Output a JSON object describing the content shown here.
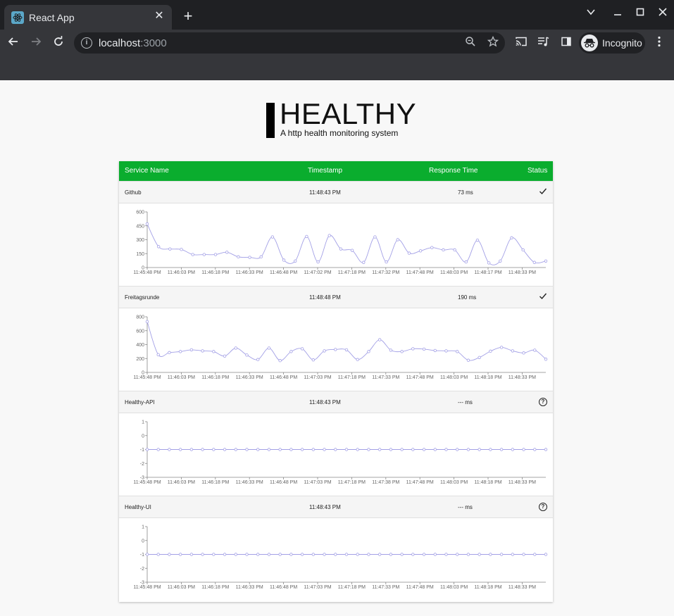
{
  "browser": {
    "tab_title": "React App",
    "url_host": "localhost",
    "url_port": ":3000",
    "profile_label": "Incognito"
  },
  "app": {
    "title": "HEALTHY",
    "subtitle": "A http health monitoring system"
  },
  "table": {
    "headers": [
      "Service Name",
      "Timestamp",
      "Response Time",
      "Status"
    ],
    "header_color": "#0aad2e"
  },
  "services": [
    {
      "name": "Github",
      "timestamp": "11:48:43 PM",
      "response": "73 ms",
      "status": "ok"
    },
    {
      "name": "Freitagsrunde",
      "timestamp": "11:48:48 PM",
      "response": "190 ms",
      "status": "ok"
    },
    {
      "name": "Healthy-API",
      "timestamp": "11:48:43 PM",
      "response": "--- ms",
      "status": "unknown"
    },
    {
      "name": "Healthy-UI",
      "timestamp": "11:48:43 PM",
      "response": "--- ms",
      "status": "unknown"
    }
  ],
  "chart_data": [
    {
      "type": "line",
      "series_color": "#a3a0e6",
      "ylim": [
        0,
        600
      ],
      "yticks": [
        "600",
        "450",
        "300",
        "150",
        "0"
      ],
      "xticks": [
        "11:45:48 PM",
        "11:46:03 PM",
        "11:46:18 PM",
        "11:46:33 PM",
        "11:46:48 PM",
        "11:47:02 PM",
        "11:47:18 PM",
        "11:47:32 PM",
        "11:47:48 PM",
        "11:48:03 PM",
        "11:48:17 PM",
        "11:48:33 PM"
      ],
      "values": [
        470,
        225,
        200,
        195,
        140,
        140,
        140,
        165,
        115,
        110,
        115,
        330,
        80,
        70,
        335,
        60,
        345,
        200,
        185,
        55,
        330,
        60,
        300,
        155,
        180,
        215,
        190,
        190,
        60,
        295,
        50,
        70,
        320,
        190,
        55,
        70
      ]
    },
    {
      "type": "line",
      "series_color": "#a3a0e6",
      "ylim": [
        0,
        800
      ],
      "yticks": [
        "800",
        "600",
        "400",
        "200",
        "0"
      ],
      "xticks": [
        "11:45:48 PM",
        "11:46:03 PM",
        "11:46:18 PM",
        "11:46:33 PM",
        "11:46:48 PM",
        "11:47:03 PM",
        "11:47:18 PM",
        "11:47:33 PM",
        "11:47:48 PM",
        "11:48:03 PM",
        "11:48:18 PM",
        "11:48:33 PM"
      ],
      "values": [
        730,
        255,
        285,
        300,
        325,
        310,
        300,
        235,
        350,
        250,
        185,
        350,
        170,
        300,
        340,
        180,
        310,
        330,
        325,
        185,
        300,
        470,
        320,
        300,
        340,
        335,
        315,
        310,
        300,
        175,
        215,
        305,
        360,
        310,
        280,
        320,
        190
      ]
    },
    {
      "type": "line",
      "series_color": "#a3a0e6",
      "ylim": [
        -3,
        1
      ],
      "yticks": [
        "1",
        "0",
        "-1",
        "-2",
        "-3"
      ],
      "xticks": [
        "11:45:48 PM",
        "11:46:03 PM",
        "11:46:18 PM",
        "11:46:33 PM",
        "11:46:48 PM",
        "11:47:03 PM",
        "11:47:18 PM",
        "11:47:38 PM",
        "11:47:48 PM",
        "11:48:03 PM",
        "11:48:18 PM",
        "11:48:33 PM"
      ],
      "values": [
        -1,
        -1,
        -1,
        -1,
        -1,
        -1,
        -1,
        -1,
        -1,
        -1,
        -1,
        -1,
        -1,
        -1,
        -1,
        -1,
        -1,
        -1,
        -1,
        -1,
        -1,
        -1,
        -1,
        -1,
        -1,
        -1,
        -1,
        -1,
        -1,
        -1,
        -1,
        -1,
        -1,
        -1,
        -1,
        -1,
        -1
      ]
    },
    {
      "type": "line",
      "series_color": "#a3a0e6",
      "ylim": [
        -3,
        1
      ],
      "yticks": [
        "1",
        "0",
        "-1",
        "-2",
        "-3"
      ],
      "xticks": [
        "11:45:48 PM",
        "11:46:03 PM",
        "11:46:18 PM",
        "11:46:33 PM",
        "11:46:48 PM",
        "11:47:03 PM",
        "11:47:18 PM",
        "11:47:33 PM",
        "11:47:48 PM",
        "11:48:03 PM",
        "11:48:18 PM",
        "11:48:33 PM"
      ],
      "values": [
        -1,
        -1,
        -1,
        -1,
        -1,
        -1,
        -1,
        -1,
        -1,
        -1,
        -1,
        -1,
        -1,
        -1,
        -1,
        -1,
        -1,
        -1,
        -1,
        -1,
        -1,
        -1,
        -1,
        -1,
        -1,
        -1,
        -1,
        -1,
        -1,
        -1,
        -1,
        -1,
        -1,
        -1,
        -1,
        -1,
        -1
      ]
    }
  ]
}
